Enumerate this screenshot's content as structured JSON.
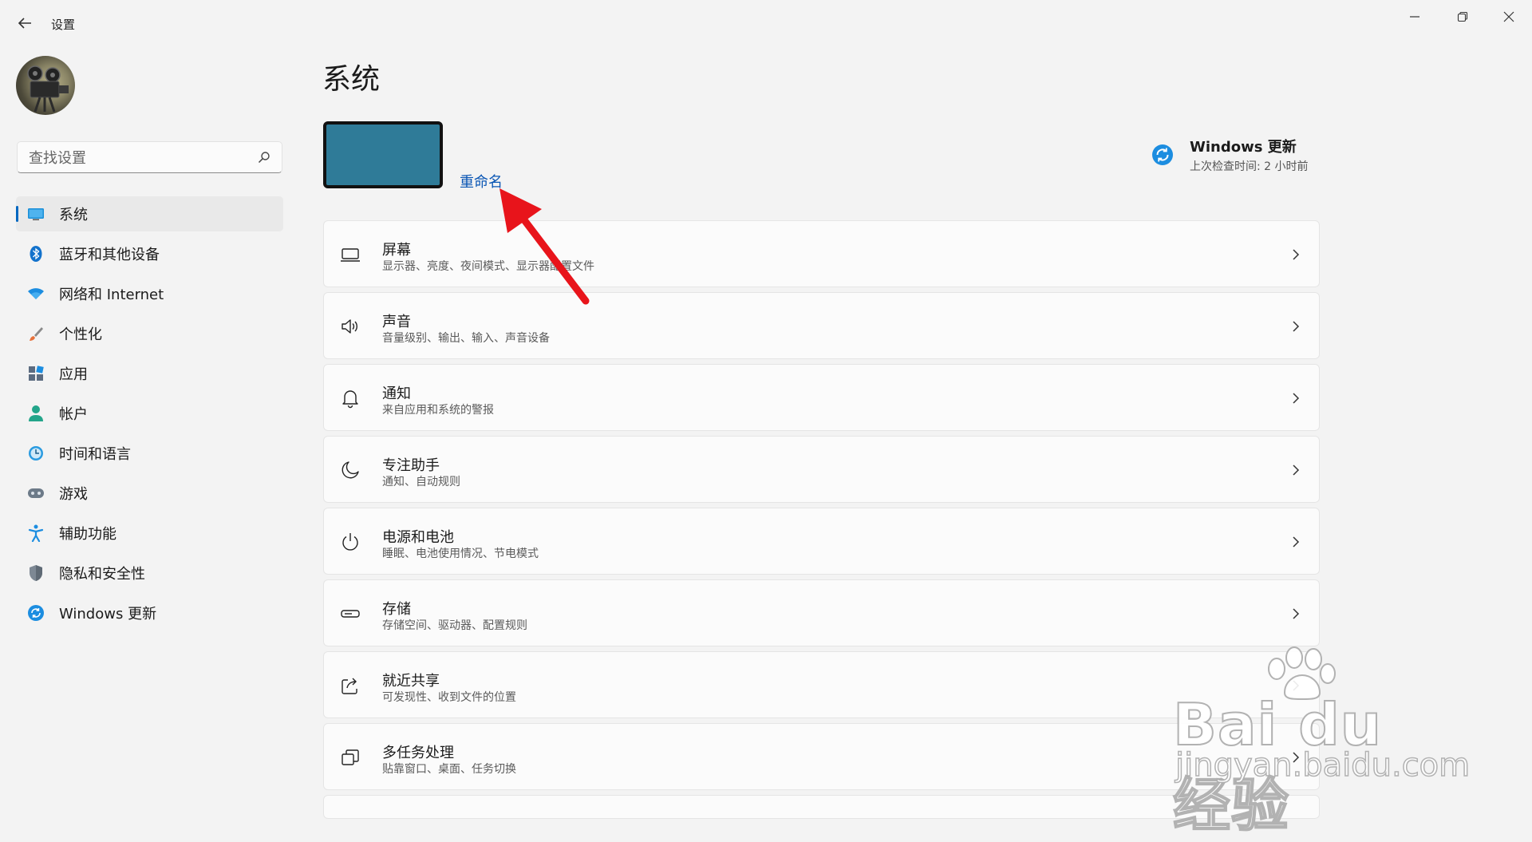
{
  "window": {
    "title": "设置"
  },
  "search": {
    "placeholder": "查找设置"
  },
  "sidebar": {
    "items": [
      {
        "label": "系统",
        "icon": "system-icon",
        "active": true
      },
      {
        "label": "蓝牙和其他设备",
        "icon": "bluetooth-icon"
      },
      {
        "label": "网络和 Internet",
        "icon": "wifi-icon"
      },
      {
        "label": "个性化",
        "icon": "brush-icon"
      },
      {
        "label": "应用",
        "icon": "apps-icon"
      },
      {
        "label": "帐户",
        "icon": "account-icon"
      },
      {
        "label": "时间和语言",
        "icon": "time-language-icon"
      },
      {
        "label": "游戏",
        "icon": "gamepad-icon"
      },
      {
        "label": "辅助功能",
        "icon": "accessibility-icon"
      },
      {
        "label": "隐私和安全性",
        "icon": "shield-icon"
      },
      {
        "label": "Windows 更新",
        "icon": "windows-update-icon"
      }
    ]
  },
  "main": {
    "title": "系统",
    "device": {
      "rename_label": "重命名",
      "thumbnail_color": "#2f7b98"
    },
    "update": {
      "title": "Windows 更新",
      "subtitle": "上次检查时间: 2 小时前"
    },
    "cards": [
      {
        "title": "屏幕",
        "subtitle": "显示器、亮度、夜间模式、显示器配置文件",
        "icon": "display-icon"
      },
      {
        "title": "声音",
        "subtitle": "音量级别、输出、输入、声音设备",
        "icon": "speaker-icon"
      },
      {
        "title": "通知",
        "subtitle": "来自应用和系统的警报",
        "icon": "bell-icon"
      },
      {
        "title": "专注助手",
        "subtitle": "通知、自动规则",
        "icon": "moon-icon"
      },
      {
        "title": "电源和电池",
        "subtitle": "睡眠、电池使用情况、节电模式",
        "icon": "power-icon"
      },
      {
        "title": "存储",
        "subtitle": "存储空间、驱动器、配置规则",
        "icon": "storage-icon"
      },
      {
        "title": "就近共享",
        "subtitle": "可发现性、收到文件的位置",
        "icon": "share-icon"
      },
      {
        "title": "多任务处理",
        "subtitle": "贴靠窗口、桌面、任务切换",
        "icon": "multitask-icon"
      }
    ]
  },
  "watermark": {
    "brand": "Bai du 经验",
    "url": "jingyan.baidu.com"
  },
  "colors": {
    "accent": "#0067c0",
    "link": "#0a56b4",
    "annotation_arrow": "#e8141b"
  }
}
